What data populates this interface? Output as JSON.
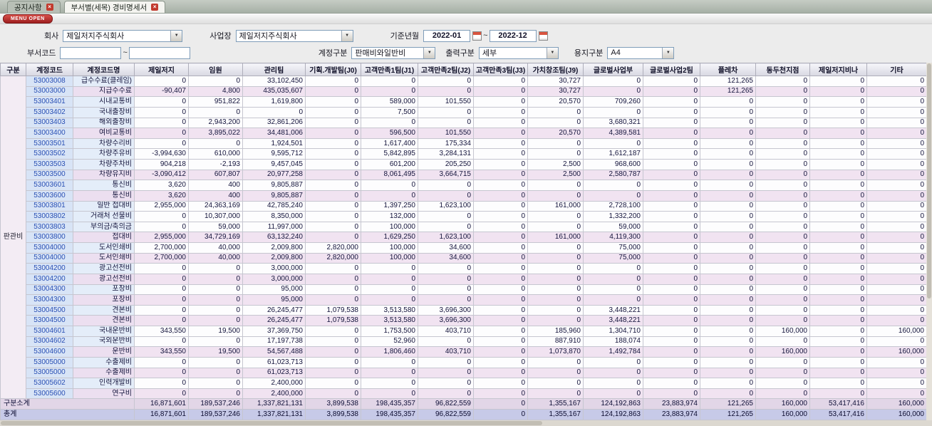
{
  "window": {
    "tabs": [
      {
        "label": "공지사항"
      },
      {
        "label": "부서별(세목) 경비명세서"
      }
    ],
    "menu_open_label": "MENU OPEN"
  },
  "colors": {
    "accent_red": "#c23a2e",
    "code_text": "#2a50b4",
    "subtotal_row_bg": "#f1e3f1",
    "grand_total_bg": "#c7cae8"
  },
  "filters": {
    "company_label": "회사",
    "company_value": "제일저지주식회사",
    "site_label": "사업장",
    "site_value": "제일저지주식회사",
    "period_label": "기준년월",
    "period_from": "2022-01",
    "period_to": "2022-12",
    "range_separator": "~",
    "dept_label": "부서코드",
    "dept_from": "",
    "dept_to": "",
    "account_label": "계정구분",
    "account_value": "판매비와일반비",
    "output_label": "출력구분",
    "output_value": "세부",
    "paper_label": "용지구분",
    "paper_value": "A4"
  },
  "table": {
    "columns": [
      "구분",
      "계정코드",
      "계정코드명",
      "제일저지",
      "임원",
      "관리팀",
      "기획.개발팀(J0)",
      "고객만족1팀(J1)",
      "고객만족2팀(J2)",
      "고객만족3팀(J3)",
      "가치창조팀(J9)",
      "글로벌사업부",
      "글로벌사업2팀",
      "플레차",
      "동두천지점",
      "제일저지비나",
      "기타"
    ],
    "group_label": "판관비",
    "rows": [
      {
        "code": "53003008",
        "name": "급수수료(클레임)",
        "sub": false,
        "values": [
          "0",
          "0",
          "33,102,450",
          "0",
          "0",
          "0",
          "0",
          "30,727",
          "0",
          "0",
          "121,265",
          "0",
          "0",
          "0"
        ]
      },
      {
        "code": "53003000",
        "name": "지급수수료",
        "sub": true,
        "values": [
          "-90,407",
          "4,800",
          "435,035,607",
          "0",
          "0",
          "0",
          "0",
          "30,727",
          "0",
          "0",
          "121,265",
          "0",
          "0",
          "0"
        ]
      },
      {
        "code": "53003401",
        "name": "시내교통비",
        "sub": false,
        "values": [
          "0",
          "951,822",
          "1,619,800",
          "0",
          "589,000",
          "101,550",
          "0",
          "20,570",
          "709,260",
          "0",
          "0",
          "0",
          "0",
          "0"
        ]
      },
      {
        "code": "53003402",
        "name": "국내출장비",
        "sub": false,
        "values": [
          "0",
          "0",
          "0",
          "0",
          "7,500",
          "0",
          "0",
          "0",
          "0",
          "0",
          "0",
          "0",
          "0",
          "0"
        ]
      },
      {
        "code": "53003403",
        "name": "해외출장비",
        "sub": false,
        "values": [
          "0",
          "2,943,200",
          "32,861,206",
          "0",
          "0",
          "0",
          "0",
          "0",
          "3,680,321",
          "0",
          "0",
          "0",
          "0",
          "0"
        ]
      },
      {
        "code": "53003400",
        "name": "여비교통비",
        "sub": true,
        "values": [
          "0",
          "3,895,022",
          "34,481,006",
          "0",
          "596,500",
          "101,550",
          "0",
          "20,570",
          "4,389,581",
          "0",
          "0",
          "0",
          "0",
          "0"
        ]
      },
      {
        "code": "53003501",
        "name": "차량수리비",
        "sub": false,
        "values": [
          "0",
          "0",
          "1,924,501",
          "0",
          "1,617,400",
          "175,334",
          "0",
          "0",
          "0",
          "0",
          "0",
          "0",
          "0",
          "0"
        ]
      },
      {
        "code": "53003502",
        "name": "차량주유비",
        "sub": false,
        "values": [
          "-3,994,630",
          "610,000",
          "9,595,712",
          "0",
          "5,842,895",
          "3,284,131",
          "0",
          "0",
          "1,612,187",
          "0",
          "0",
          "0",
          "0",
          "0"
        ]
      },
      {
        "code": "53003503",
        "name": "차량주차비",
        "sub": false,
        "values": [
          "904,218",
          "-2,193",
          "9,457,045",
          "0",
          "601,200",
          "205,250",
          "0",
          "2,500",
          "968,600",
          "0",
          "0",
          "0",
          "0",
          "0"
        ]
      },
      {
        "code": "53003500",
        "name": "차량유지비",
        "sub": true,
        "values": [
          "-3,090,412",
          "607,807",
          "20,977,258",
          "0",
          "8,061,495",
          "3,664,715",
          "0",
          "2,500",
          "2,580,787",
          "0",
          "0",
          "0",
          "0",
          "0"
        ]
      },
      {
        "code": "53003601",
        "name": "통신비",
        "sub": false,
        "values": [
          "3,620",
          "400",
          "9,805,887",
          "0",
          "0",
          "0",
          "0",
          "0",
          "0",
          "0",
          "0",
          "0",
          "0",
          "0"
        ]
      },
      {
        "code": "53003600",
        "name": "통신비",
        "sub": true,
        "values": [
          "3,620",
          "400",
          "9,805,887",
          "0",
          "0",
          "0",
          "0",
          "0",
          "0",
          "0",
          "0",
          "0",
          "0",
          "0"
        ]
      },
      {
        "code": "53003801",
        "name": "일반 접대비",
        "sub": false,
        "values": [
          "2,955,000",
          "24,363,169",
          "42,785,240",
          "0",
          "1,397,250",
          "1,623,100",
          "0",
          "161,000",
          "2,728,100",
          "0",
          "0",
          "0",
          "0",
          "0"
        ]
      },
      {
        "code": "53003802",
        "name": "거래처 선물비",
        "sub": false,
        "values": [
          "0",
          "10,307,000",
          "8,350,000",
          "0",
          "132,000",
          "0",
          "0",
          "0",
          "1,332,200",
          "0",
          "0",
          "0",
          "0",
          "0"
        ]
      },
      {
        "code": "53003803",
        "name": "부의금/축의금",
        "sub": false,
        "values": [
          "0",
          "59,000",
          "11,997,000",
          "0",
          "100,000",
          "0",
          "0",
          "0",
          "59,000",
          "0",
          "0",
          "0",
          "0",
          "0"
        ]
      },
      {
        "code": "53003800",
        "name": "접대비",
        "sub": true,
        "values": [
          "2,955,000",
          "34,729,169",
          "63,132,240",
          "0",
          "1,629,250",
          "1,623,100",
          "0",
          "161,000",
          "4,119,300",
          "0",
          "0",
          "0",
          "0",
          "0"
        ]
      },
      {
        "code": "53004000",
        "name": "도서인쇄비",
        "sub": false,
        "values": [
          "2,700,000",
          "40,000",
          "2,009,800",
          "2,820,000",
          "100,000",
          "34,600",
          "0",
          "0",
          "75,000",
          "0",
          "0",
          "0",
          "0",
          "0"
        ]
      },
      {
        "code": "53004000",
        "name": "도서인쇄비",
        "sub": true,
        "values": [
          "2,700,000",
          "40,000",
          "2,009,800",
          "2,820,000",
          "100,000",
          "34,600",
          "0",
          "0",
          "75,000",
          "0",
          "0",
          "0",
          "0",
          "0"
        ]
      },
      {
        "code": "53004200",
        "name": "광고선전비",
        "sub": false,
        "values": [
          "0",
          "0",
          "3,000,000",
          "0",
          "0",
          "0",
          "0",
          "0",
          "0",
          "0",
          "0",
          "0",
          "0",
          "0"
        ]
      },
      {
        "code": "53004200",
        "name": "광고선전비",
        "sub": true,
        "values": [
          "0",
          "0",
          "3,000,000",
          "0",
          "0",
          "0",
          "0",
          "0",
          "0",
          "0",
          "0",
          "0",
          "0",
          "0"
        ]
      },
      {
        "code": "53004300",
        "name": "포장비",
        "sub": false,
        "values": [
          "0",
          "0",
          "95,000",
          "0",
          "0",
          "0",
          "0",
          "0",
          "0",
          "0",
          "0",
          "0",
          "0",
          "0"
        ]
      },
      {
        "code": "53004300",
        "name": "포장비",
        "sub": true,
        "values": [
          "0",
          "0",
          "95,000",
          "0",
          "0",
          "0",
          "0",
          "0",
          "0",
          "0",
          "0",
          "0",
          "0",
          "0"
        ]
      },
      {
        "code": "53004500",
        "name": "견본비",
        "sub": false,
        "values": [
          "0",
          "0",
          "26,245,477",
          "1,079,538",
          "3,513,580",
          "3,696,300",
          "0",
          "0",
          "3,448,221",
          "0",
          "0",
          "0",
          "0",
          "0"
        ]
      },
      {
        "code": "53004500",
        "name": "견본비",
        "sub": true,
        "values": [
          "0",
          "0",
          "26,245,477",
          "1,079,538",
          "3,513,580",
          "3,696,300",
          "0",
          "0",
          "3,448,221",
          "0",
          "0",
          "0",
          "0",
          "0"
        ]
      },
      {
        "code": "53004601",
        "name": "국내운반비",
        "sub": false,
        "values": [
          "343,550",
          "19,500",
          "37,369,750",
          "0",
          "1,753,500",
          "403,710",
          "0",
          "185,960",
          "1,304,710",
          "0",
          "0",
          "160,000",
          "0",
          "160,000"
        ]
      },
      {
        "code": "53004602",
        "name": "국외운반비",
        "sub": false,
        "values": [
          "0",
          "0",
          "17,197,738",
          "0",
          "52,960",
          "0",
          "0",
          "887,910",
          "188,074",
          "0",
          "0",
          "0",
          "0",
          "0"
        ]
      },
      {
        "code": "53004600",
        "name": "운반비",
        "sub": true,
        "values": [
          "343,550",
          "19,500",
          "54,567,488",
          "0",
          "1,806,460",
          "403,710",
          "0",
          "1,073,870",
          "1,492,784",
          "0",
          "0",
          "160,000",
          "0",
          "160,000"
        ]
      },
      {
        "code": "53005000",
        "name": "수출제비",
        "sub": false,
        "values": [
          "0",
          "0",
          "61,023,713",
          "0",
          "0",
          "0",
          "0",
          "0",
          "0",
          "0",
          "0",
          "0",
          "0",
          "0"
        ]
      },
      {
        "code": "53005000",
        "name": "수출제비",
        "sub": true,
        "values": [
          "0",
          "0",
          "61,023,713",
          "0",
          "0",
          "0",
          "0",
          "0",
          "0",
          "0",
          "0",
          "0",
          "0",
          "0"
        ]
      },
      {
        "code": "53005602",
        "name": "인력개발비",
        "sub": false,
        "values": [
          "0",
          "0",
          "2,400,000",
          "0",
          "0",
          "0",
          "0",
          "0",
          "0",
          "0",
          "0",
          "0",
          "0",
          "0"
        ]
      },
      {
        "code": "53005600",
        "name": "연구비",
        "sub": true,
        "values": [
          "0",
          "0",
          "2,400,000",
          "0",
          "0",
          "0",
          "0",
          "0",
          "0",
          "0",
          "0",
          "0",
          "0",
          "0"
        ]
      }
    ],
    "subtotal_row": {
      "label": "구분소계",
      "values": [
        "16,871,601",
        "189,537,246",
        "1,337,821,131",
        "3,899,538",
        "198,435,357",
        "96,822,559",
        "0",
        "1,355,167",
        "124,192,863",
        "23,883,974",
        "121,265",
        "160,000",
        "53,417,416",
        "160,000"
      ]
    },
    "total_row": {
      "label": "총계",
      "values": [
        "16,871,601",
        "189,537,246",
        "1,337,821,131",
        "3,899,538",
        "198,435,357",
        "96,822,559",
        "0",
        "1,355,167",
        "124,192,863",
        "23,883,974",
        "121,265",
        "160,000",
        "53,417,416",
        "160,000"
      ]
    }
  }
}
